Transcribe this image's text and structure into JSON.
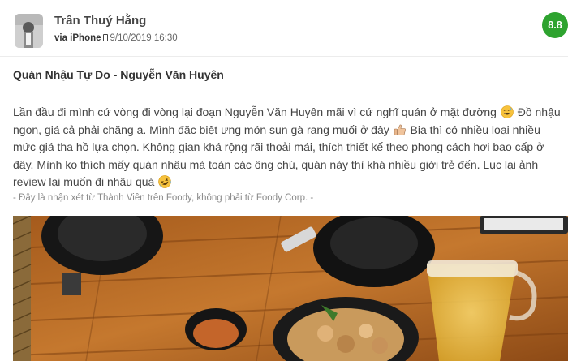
{
  "review": {
    "author": "Trần Thuý Hằng",
    "device": "via iPhone",
    "device_icon": "phone-icon",
    "timestamp": "9/10/2019 16:30",
    "score": "8.8",
    "score_color": "#2ea32f",
    "title": "Quán Nhậu Tự Do - Nguyễn Văn Huyên",
    "body": {
      "s1": "Lần đầu đi mình cứ vòng đi vòng lại đoạn Nguyễn Văn Huyên mãi vì cứ nghĩ quán ở mặt đường",
      "s2": "Đồ nhậu ngon, giá cả phải chăng ạ. Mình đặc biệt ưng món sụn gà rang muối ở đây",
      "s3": "Bia thì có nhiều loại nhiều mức giá tha hồ lựa chọn. Không gian khá rộng rãi thoải mái, thích thiết kế theo phong cách hơi bao cấp ở đây. Mình ko thích mấy quán nhậu mà toàn các ông chú, quán này thì khá nhiều giới trẻ đến. Lục lại ảnh review lại muốn đi nhậu quá",
      "emoji_1": "grinning-sweat-emoji",
      "emoji_2": "thumbs-up-emoji",
      "emoji_3": "rolling-laughing-emoji"
    },
    "disclaimer": "- Đây là nhận xét từ Thành Viên trên Foody, không phải từ Foody Corp. -",
    "photo": "review-photo-food-table"
  }
}
